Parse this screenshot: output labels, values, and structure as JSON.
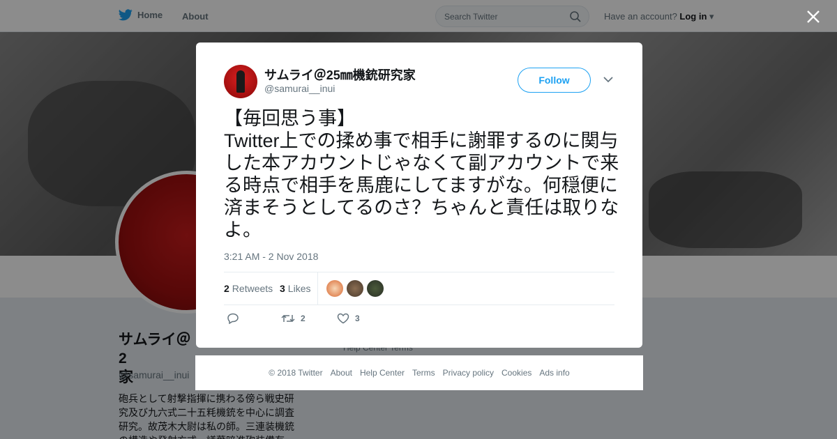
{
  "nav": {
    "home_label": "Home",
    "about_label": "About",
    "search_placeholder": "Search Twitter",
    "login_prompt": "Have an account?",
    "login_label": "Log in"
  },
  "background_profile": {
    "display_name": "サムライ＠2",
    "name_line2": "家",
    "handle": "@samurai__inui",
    "bio": "砲兵として射撃指揮に携わる傍ら戦史研究及び九六式二十五粍機銃を中心に調査研究。故茂木大尉は私の師。三連装機銃の構造や発射方式、議葉暗進砲装備有",
    "help_links": "Help Center  Terms"
  },
  "tweet": {
    "display_name": "サムライ＠25㎜機銃研究家",
    "handle": "@samurai__inui",
    "follow_label": "Follow",
    "text": "【毎回思う事】\nTwitter上での揉め事で相手に謝罪するのに関与した本アカウントじゃなくて副アカウントで来る時点で相手を馬鹿にしてますがな。何穏便に済まそうとしてるのさ？ちゃんと責任は取りなよ。",
    "timestamp": "3:21 AM - 2 Nov 2018",
    "retweets_count": "2",
    "retweets_label": "Retweets",
    "likes_count": "3",
    "likes_label": "Likes",
    "action_retweet_count": "2",
    "action_like_count": "3"
  },
  "footer": {
    "copyright": "© 2018 Twitter",
    "links": [
      "About",
      "Help Center",
      "Terms",
      "Privacy policy",
      "Cookies",
      "Ads info"
    ]
  },
  "colors": {
    "brand_blue": "#1da1f2",
    "text_primary": "#14171a",
    "text_secondary": "#66757f"
  }
}
